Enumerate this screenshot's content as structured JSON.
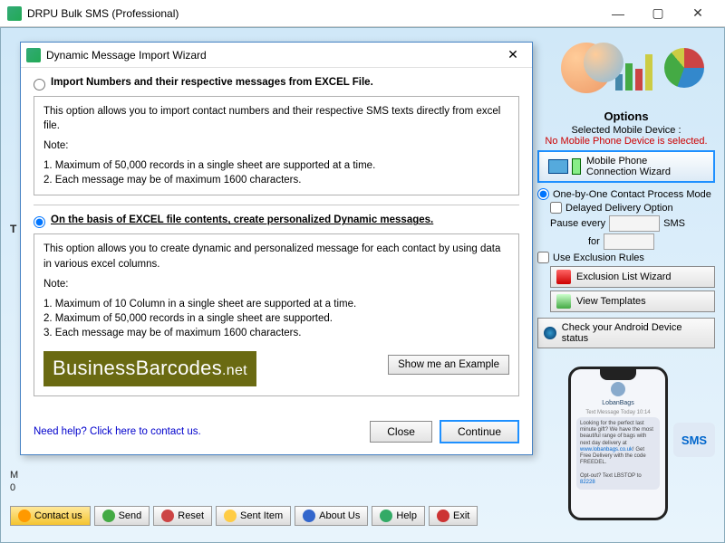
{
  "app": {
    "title": "DRPU Bulk SMS (Professional)"
  },
  "modal": {
    "title": "Dynamic Message Import Wizard",
    "option1": {
      "label": "Import Numbers and their respective messages from EXCEL File.",
      "desc": "This option allows you to import contact numbers and their respective SMS texts directly from excel file.",
      "note_title": "Note:",
      "note1": "1. Maximum of 50,000 records in a single sheet are supported at a time.",
      "note2": "2. Each message may be of maximum 1600 characters."
    },
    "option2": {
      "label": "On the basis of EXCEL file contents, create personalized Dynamic messages.",
      "desc": "This option allows you to create dynamic and personalized message for each contact by using data in various excel columns.",
      "note_title": "Note:",
      "note1": "1. Maximum of 10 Column in a single sheet are supported at a time.",
      "note2": "2. Maximum of 50,000 records in a single sheet are supported.",
      "note3": "3. Each message may be of maximum 1600 characters."
    },
    "watermark": "BusinessBarcodes",
    "watermark_suffix": ".net",
    "example_btn": "Show me an Example",
    "help_link": "Need help? Click here to contact us.",
    "close_btn": "Close",
    "continue_btn": "Continue"
  },
  "options": {
    "title": "Options",
    "selected_label": "Selected Mobile Device :",
    "selected_value": "No Mobile Phone Device is selected.",
    "wizard_line1": "Mobile Phone",
    "wizard_line2": "Connection  Wizard",
    "mode_label": "One-by-One Contact Process Mode",
    "delayed_label": "Delayed Delivery Option",
    "pause_label": "Pause every",
    "pause_unit": "SMS",
    "for_label": "for",
    "exclusion_label": "Use Exclusion Rules",
    "exclusion_btn": "Exclusion List Wizard",
    "templates_btn": "View Templates",
    "android_btn": "Check your Android Device status"
  },
  "phone": {
    "contact": "LobanBags",
    "msg_label": "Text Message\nToday 10:14",
    "bubble1a": "Looking for the perfect last minute gift? We have the most beautiful range of bags with next day delivery at ",
    "bubble1_link": "www.lobanbags.co.uk",
    "bubble1b": "! Get Free Delivery with the code FREEDEL.",
    "bubble2a": "Opt-out? Text LBSTOP to ",
    "bubble2_link": "82228"
  },
  "sms_badge": "SMS",
  "toolbar": {
    "contact": "Contact us",
    "send": "Send",
    "reset": "Reset",
    "sent": "Sent Item",
    "about": "About Us",
    "help": "Help",
    "exit": "Exit"
  },
  "edges": {
    "t": "T",
    "m": "M",
    "zero": "0"
  }
}
